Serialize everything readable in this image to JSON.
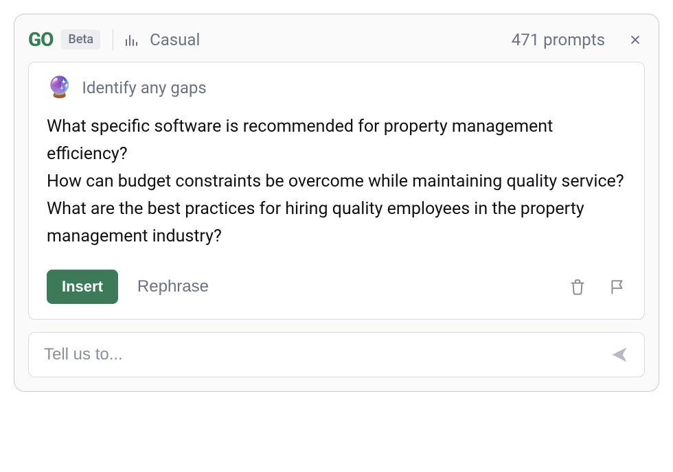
{
  "header": {
    "logo_text": "GO",
    "badge": "Beta",
    "tone": "Casual",
    "prompts_text": "471 prompts"
  },
  "card": {
    "icon": "🔮",
    "title": "Identify any gaps",
    "body": "What specific software is recommended for property management efficiency?\nHow can budget constraints be overcome while maintaining quality service?\nWhat are the best practices for hiring quality employees in the property management industry?",
    "insert_label": "Insert",
    "rephrase_label": "Rephrase"
  },
  "input": {
    "placeholder": "Tell us to..."
  }
}
